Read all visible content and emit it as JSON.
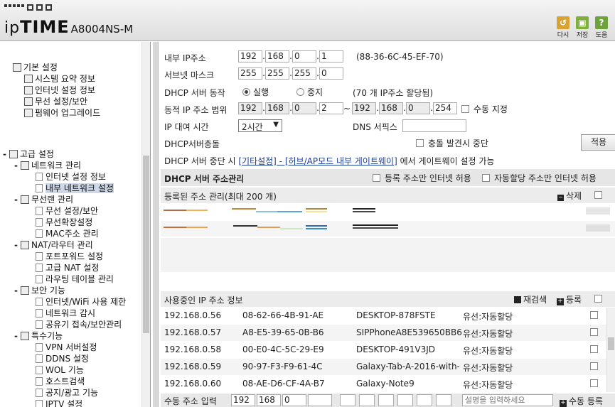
{
  "header": {
    "brand_prefix": "ip",
    "brand_main": "TIME",
    "model": "A8004NS-M",
    "buttons": [
      {
        "label": "다시",
        "icon": "reload-icon",
        "color": "#d9a333"
      },
      {
        "label": "저장",
        "icon": "save-icon",
        "color": "#7fb03a"
      },
      {
        "label": "도움",
        "icon": "help-icon",
        "color": "#6da23c"
      }
    ]
  },
  "sidebar": {
    "basic": {
      "title": "기본 설정",
      "items": [
        "시스템 요약 정보",
        "인터넷 설정 정보",
        "무선 설정/보안",
        "펌웨어 업그레이드"
      ]
    },
    "advanced": {
      "title": "고급 설정",
      "groups": [
        {
          "title": "네트워크 관리",
          "items": [
            "인터넷 설정 정보",
            "내부 네트워크 설정"
          ]
        },
        {
          "title": "무선랜 관리",
          "items": [
            "무선 설정/보안",
            "무선확장설정",
            "MAC주소 관리"
          ]
        },
        {
          "title": "NAT/라우터 관리",
          "items": [
            "포트포워드 설정",
            "고급 NAT 설정",
            "라우팅 테이블 관리"
          ]
        },
        {
          "title": "보안 기능",
          "items": [
            "인터넷/WiFi 사용 제한",
            "네트워크 감시",
            "공유기 접속/보안관리"
          ]
        },
        {
          "title": "특수기능",
          "items": [
            "VPN 서버설정",
            "DDNS 설정",
            "WOL 기능",
            "호스트검색",
            "공지/광고 기능",
            "IPTV 설정"
          ]
        }
      ],
      "selected": "내부 네트워크 설정"
    }
  },
  "form": {
    "lan_ip": {
      "label": "내부 IP주소",
      "octets": [
        "192",
        "168",
        "0",
        "1"
      ],
      "mac": "(88-36-6C-45-EF-70)"
    },
    "subnet": {
      "label": "서브넷 마스크",
      "octets": [
        "255",
        "255",
        "255",
        "0"
      ]
    },
    "dhcp": {
      "label": "DHCP 서버 동작",
      "on": "실행",
      "off": "중지",
      "note": "(70 개 IP주소 할당됨)"
    },
    "range": {
      "label": "동적 IP 주소 범위",
      "start": [
        "192",
        "168",
        "0",
        "2"
      ],
      "tilde": "~",
      "end": [
        "192",
        "168",
        "0",
        "254"
      ],
      "manual": "수동 지정"
    },
    "lease": {
      "label": "IP 대여 시간",
      "value": "2시간",
      "dns_label": "DNS 서픽스",
      "dns_value": ""
    },
    "conflict": {
      "label": "DHCP서버충돌",
      "stop": "충돌 발견시 중단",
      "apply": "적용"
    },
    "notice": {
      "prefix": "DHCP 서버 중단 시 ",
      "link": "[기타설정] - [허브/AP모드 내부 게이트웨이]",
      "suffix": " 에서 게이트웨이 설정 가능"
    }
  },
  "dhcp_mgmt": {
    "title": "DHCP 서버 주소관리",
    "opt1": "등록 주소만 인터넷 허용",
    "opt2": "자동할당 주소만 인터넷 허용",
    "registered_title": "등록된 주소 관리(최대 200 개)",
    "delete": "삭제"
  },
  "in_use": {
    "title": "사용중인 IP 주소 정보",
    "rescan": "재검색",
    "register": "등록",
    "rows": [
      {
        "ip": "192.168.0.56",
        "mac": "08-62-66-4B-91-AE",
        "name": "DESKTOP-878FSTE",
        "type": "유선:자동할당"
      },
      {
        "ip": "192.168.0.57",
        "mac": "A8-E5-39-65-0B-B6",
        "name": "SIPPhoneA8E539650BB6",
        "type": "유선:자동할당"
      },
      {
        "ip": "192.168.0.58",
        "mac": "00-E0-4C-5C-29-E9",
        "name": "DESKTOP-491V3JD",
        "type": "유선:자동할당"
      },
      {
        "ip": "192.168.0.59",
        "mac": "90-97-F3-F9-61-4C",
        "name": "Galaxy-Tab-A-2016-with-",
        "type": "유선:자동할당"
      },
      {
        "ip": "192.168.0.60",
        "mac": "08-AE-D6-CF-4A-B7",
        "name": "Galaxy-Note9",
        "type": "유선:자동할당"
      }
    ]
  },
  "manual_entry": {
    "label": "수동 주소 입력",
    "octets": [
      "192",
      "168",
      "0",
      ""
    ],
    "placeholder": "설명을 입력하세요",
    "register": "수동 등록"
  }
}
